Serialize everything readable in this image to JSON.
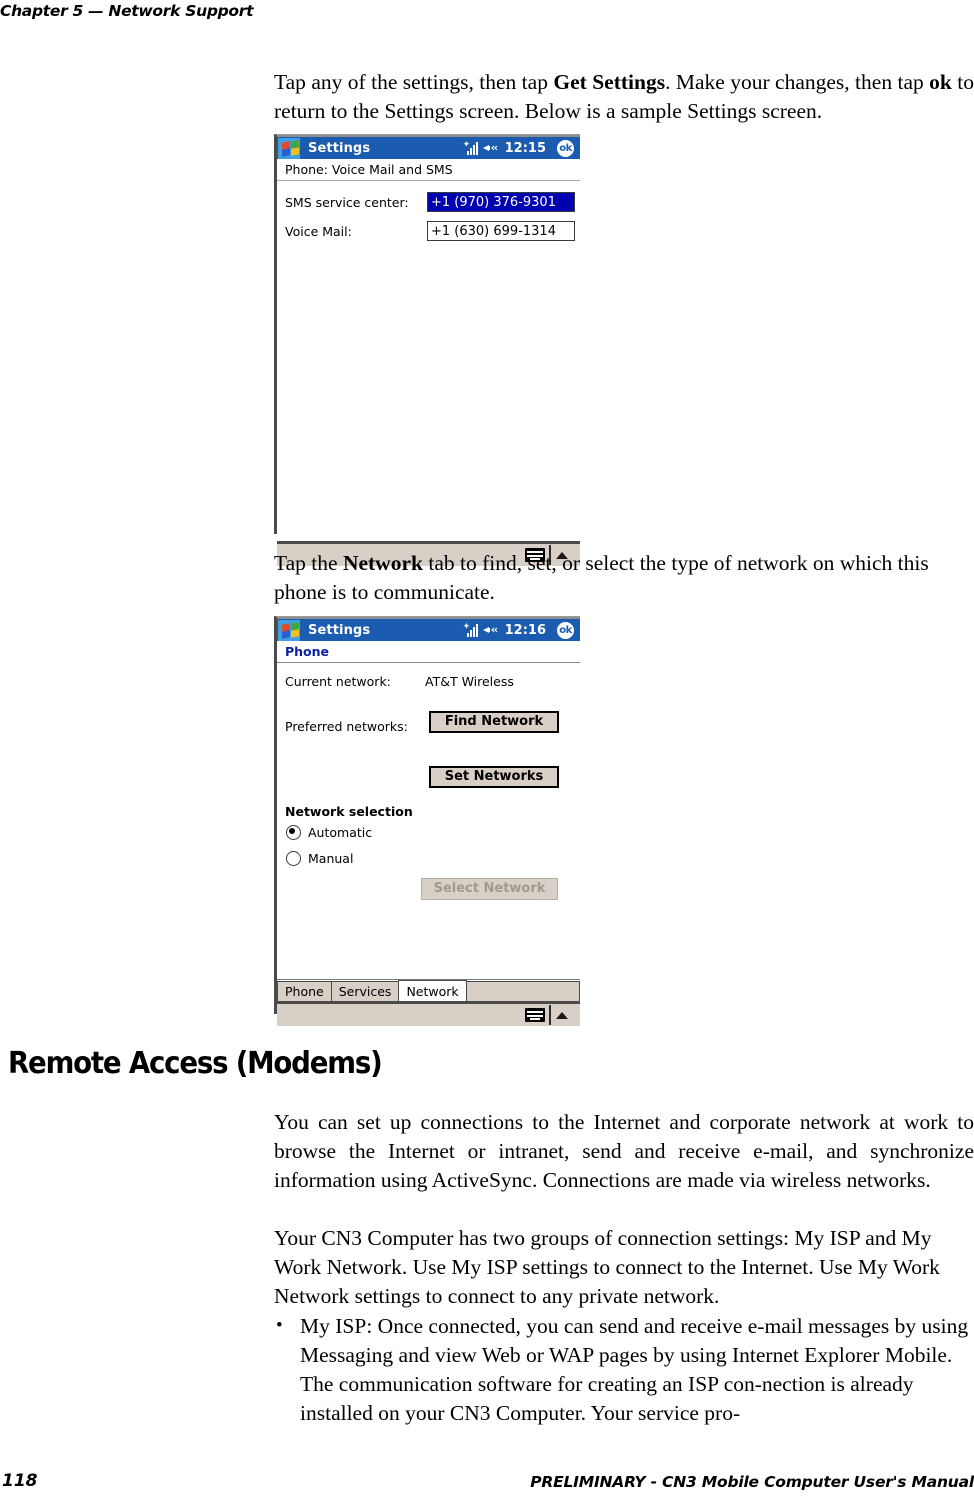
{
  "running_head": "Chapter 5 — Network Support",
  "paragraphs": {
    "p1_a": "Tap any of the settings, then tap ",
    "p1_b": "Get Settings",
    "p1_c": ". Make your changes, then tap ",
    "p1_d": "ok",
    "p1_e": " to return to the Settings screen. Below is a sample Settings screen.",
    "p2_a": "Tap the ",
    "p2_b": "Network",
    "p2_c": " tab to find, set, or select the type of network on which this phone is to communicate.",
    "p3": "You can set up connections to the Internet and corporate network at work to browse the Internet or intranet, send and receive e-mail, and synchronize information using ActiveSync. Connections are made via wireless networks.",
    "p4": "Your CN3 Computer has two groups of connection settings: My ISP and My Work Network. Use My ISP settings to connect to the Internet. Use My Work Network settings to connect to any private network.",
    "bullet1": "My ISP: Once connected, you can send and receive e-mail messages by using Messaging and view Web or WAP pages by using Internet Explorer Mobile. The communication software for creating an ISP con-nection is already installed on your CN3 Computer. Your service pro-",
    "bullet_glyph": "•"
  },
  "section_heading": "Remote Access (Modems)",
  "footer": {
    "page_number": "118",
    "manual_title": "PRELIMINARY - CN3 Mobile Computer User's Manual"
  },
  "screenshot1": {
    "title_app": "Settings",
    "clock": "12:15",
    "ok_label": "ok",
    "subheader": "Phone: Voice Mail and SMS",
    "rows": [
      {
        "label": "SMS service center:",
        "value": "+1 (970) 376-9301",
        "selected": true
      },
      {
        "label": "Voice Mail:",
        "value": "+1 (630) 699-1314",
        "selected": false
      }
    ]
  },
  "screenshot2": {
    "title_app": "Settings",
    "clock": "12:16",
    "ok_label": "ok",
    "subheader": "Phone",
    "current_network_label": "Current network:",
    "current_network_value": "AT&T Wireless",
    "find_network_button": "Find Network",
    "preferred_networks_label": "Preferred networks:",
    "set_networks_button": "Set Networks",
    "network_selection_label": "Network selection",
    "radio_automatic": "Automatic",
    "radio_manual": "Manual",
    "radio_selected": "Automatic",
    "select_network_button": "Select Network",
    "tabs": [
      {
        "label": "Phone",
        "active": false
      },
      {
        "label": "Services",
        "active": false
      },
      {
        "label": "Network",
        "active": true
      }
    ]
  },
  "colors": {
    "titlebar_blue": "#1b5cb0",
    "selection_blue": "#0000b0",
    "chrome_tan": "#d8cfc6",
    "subhead_blue": "#0a1fa8"
  }
}
